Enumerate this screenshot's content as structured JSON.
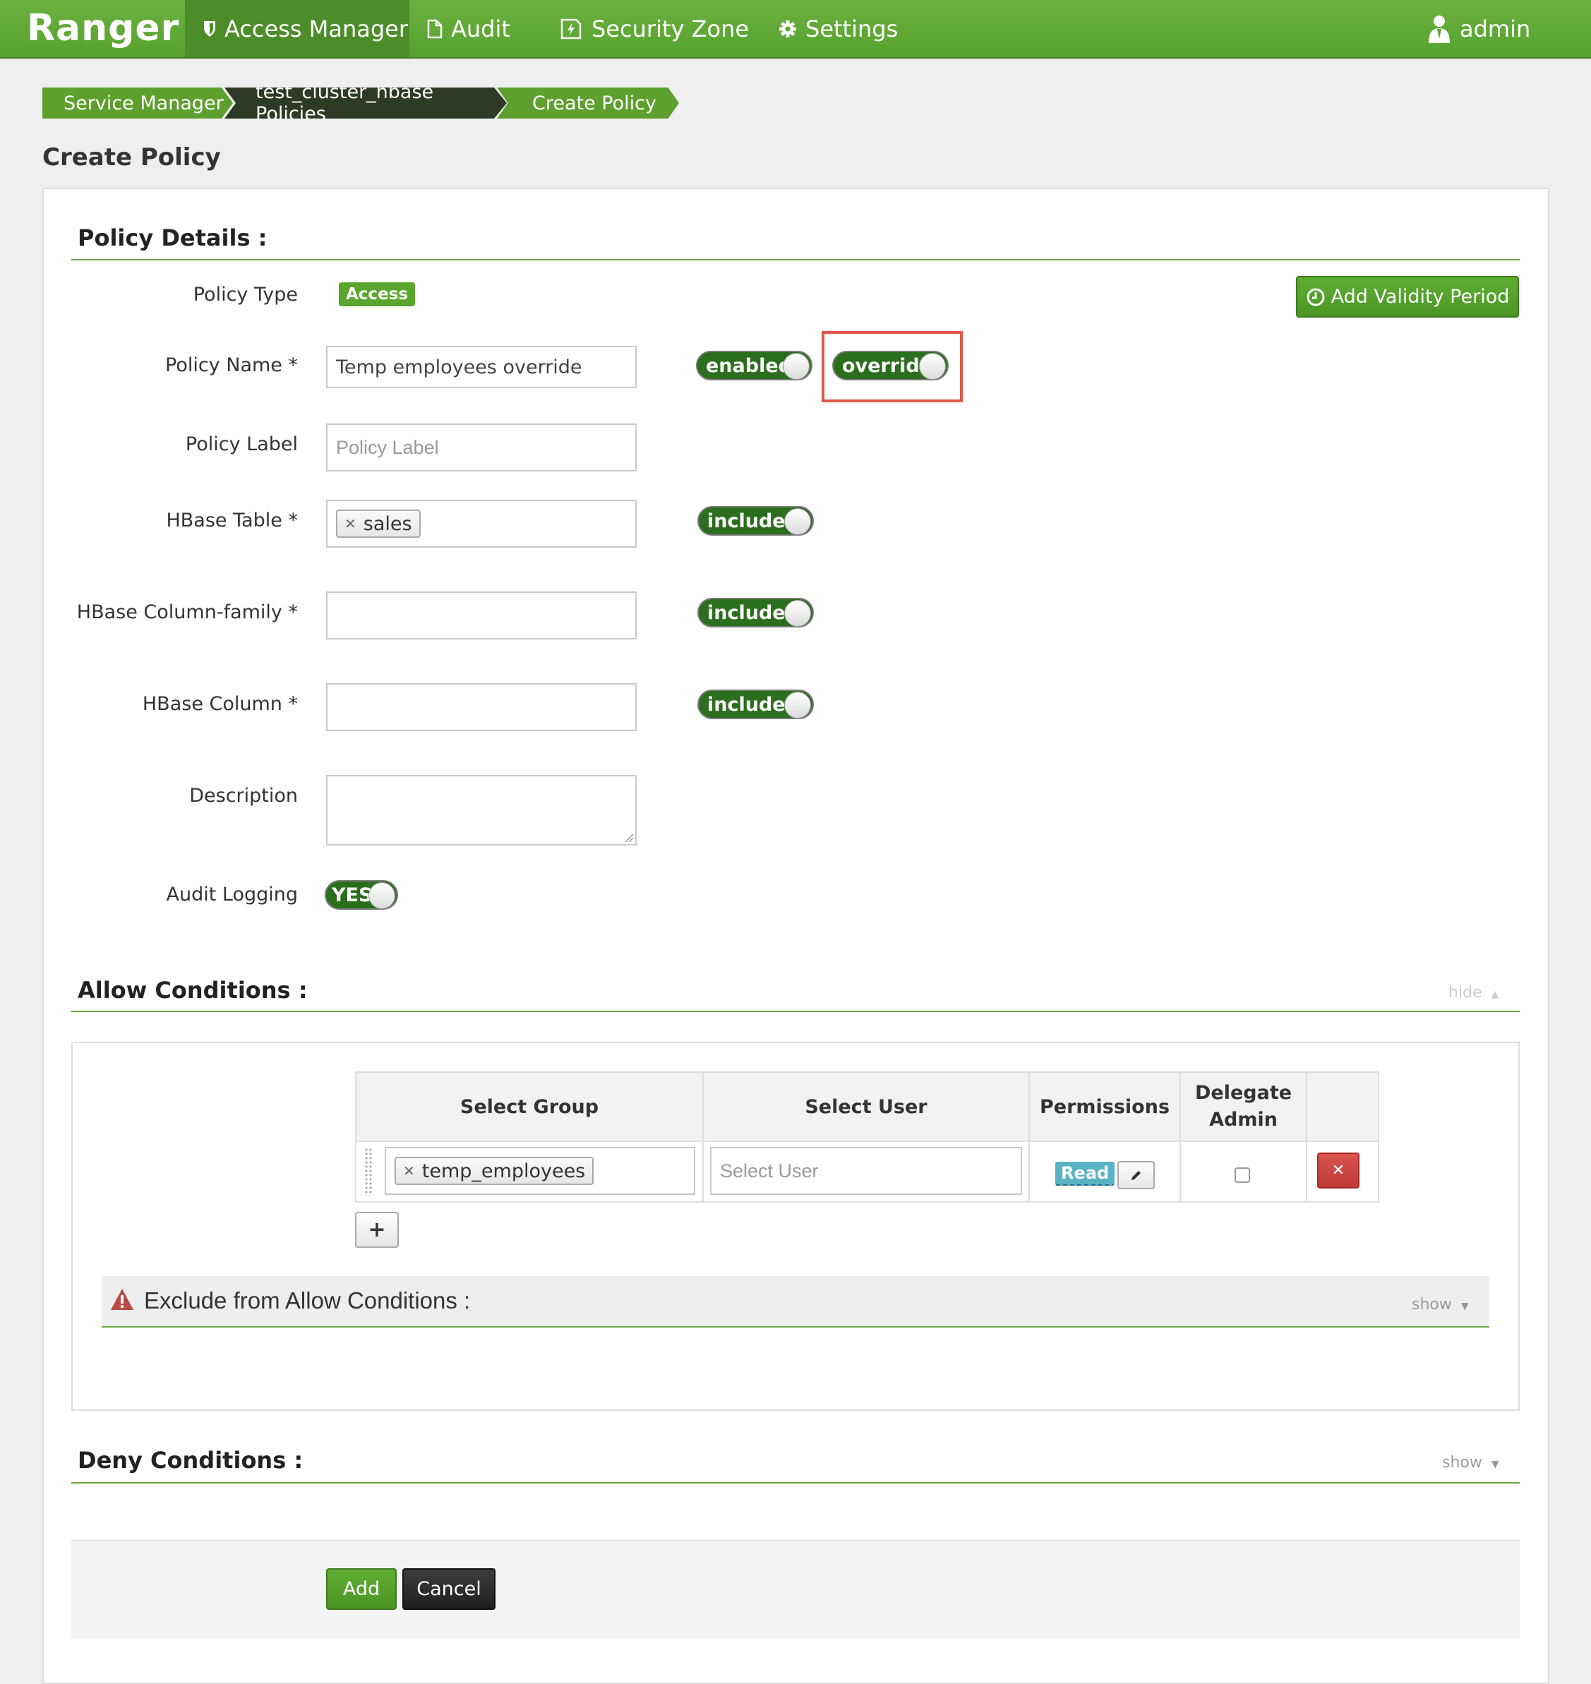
{
  "app": {
    "brand": "Ranger"
  },
  "nav": {
    "access_manager": "Access Manager",
    "audit": "Audit",
    "security_zone": "Security Zone",
    "settings": "Settings",
    "user": "admin"
  },
  "breadcrumb": [
    "Service Manager",
    "test_cluster_hbase Policies",
    "Create Policy"
  ],
  "page_title": "Create Policy",
  "policy_details": {
    "title": "Policy Details :",
    "add_validity_label": "Add Validity Period",
    "policy_type_label": "Policy Type",
    "policy_type_value": "Access",
    "policy_name_label": "Policy Name *",
    "policy_name_value": "Temp employees override",
    "enabled_toggle": "enabled",
    "override_toggle": "override",
    "policy_label_label": "Policy Label",
    "policy_label_placeholder": "Policy Label",
    "hbase_table_label": "HBase Table *",
    "hbase_table_tag": "sales",
    "hbase_cf_label": "HBase Column-family *",
    "hbase_column_label": "HBase Column *",
    "include_toggle": "include",
    "description_label": "Description",
    "audit_logging_label": "Audit Logging",
    "audit_logging_value": "YES"
  },
  "allow_conditions": {
    "title": "Allow Conditions :",
    "toggle": "hide",
    "columns": [
      "Select Group",
      "Select User",
      "Permissions",
      "Delegate Admin"
    ],
    "row": {
      "group_tag": "temp_employees",
      "user_placeholder": "Select User",
      "permission": "Read",
      "delegate_admin": false
    },
    "exclude_title": "Exclude from Allow Conditions :",
    "exclude_toggle": "show"
  },
  "deny_conditions": {
    "title": "Deny Conditions :",
    "toggle": "show"
  },
  "footer": {
    "add": "Add",
    "cancel": "Cancel"
  },
  "colors": {
    "brand_green": "#5aa52c",
    "dark_green_toggle": "#2b6e1d",
    "highlight_red": "#e0574a",
    "delete_red": "#d9534f",
    "read_badge": "#59b3c4"
  }
}
